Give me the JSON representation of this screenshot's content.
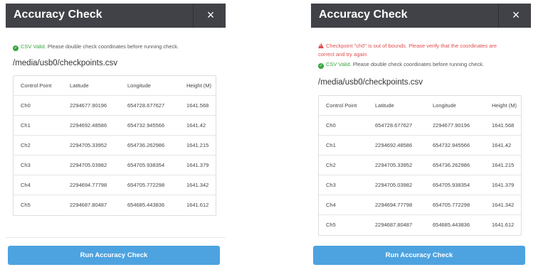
{
  "colors": {
    "header_bg": "#404247",
    "valid_green": "#3aa63f",
    "error_red": "#e04e4e",
    "button_blue": "#4da3e0"
  },
  "icons": {
    "close": "×",
    "check": "✓",
    "warning": "!"
  },
  "left": {
    "title": "Accuracy Check",
    "valid_label": "CSV Valid.",
    "valid_text": "Please double check coordinates before running check.",
    "path": "/media/usb0/checkpoints.csv",
    "columns": [
      "Control Point",
      "Latitude",
      "Longitude",
      "Height (M)"
    ],
    "rows": [
      [
        "Ch0",
        "2294677.90196",
        "654728.677627",
        "1641.568"
      ],
      [
        "Ch1",
        "2294692.48586",
        "654732.945566",
        "1641.42"
      ],
      [
        "Ch2",
        "2294705.33952",
        "654736.262986",
        "1641.215"
      ],
      [
        "Ch3",
        "2294705.03982",
        "654705.938354",
        "1641.379"
      ],
      [
        "Ch4",
        "2294694.77798",
        "654705.772298",
        "1641.342"
      ],
      [
        "Ch5",
        "2294687.80487",
        "654685.443836",
        "1641.612"
      ]
    ],
    "button": "Run Accuracy Check"
  },
  "right": {
    "title": "Accuracy Check",
    "error_line1": "Checkpoint \"ch0\" is out of bounds. Please verify that the coordinates are",
    "error_line2": "correct and try again",
    "valid_label": "CSV Valid.",
    "valid_text": "Please double check coordinates before running check.",
    "path": "/media/usb0/checkpoints.csv",
    "columns": [
      "Control Point",
      "Latitude",
      "Longitude",
      "Height (M)"
    ],
    "rows": [
      [
        "Ch0",
        "654728.677627",
        "2294677.90196",
        "1641.568"
      ],
      [
        "Ch1",
        "2294692.48586",
        "654732.945566",
        "1641.42"
      ],
      [
        "Ch2",
        "2294705.33952",
        "654736.262986",
        "1641.215"
      ],
      [
        "Ch3",
        "2294705.03982",
        "654705.938354",
        "1641.379"
      ],
      [
        "Ch4",
        "2294694.77798",
        "654705.772298",
        "1641.342"
      ],
      [
        "Ch5",
        "2294687.80487",
        "654685.443836",
        "1641.612"
      ]
    ],
    "button": "Run Accuracy Check"
  }
}
